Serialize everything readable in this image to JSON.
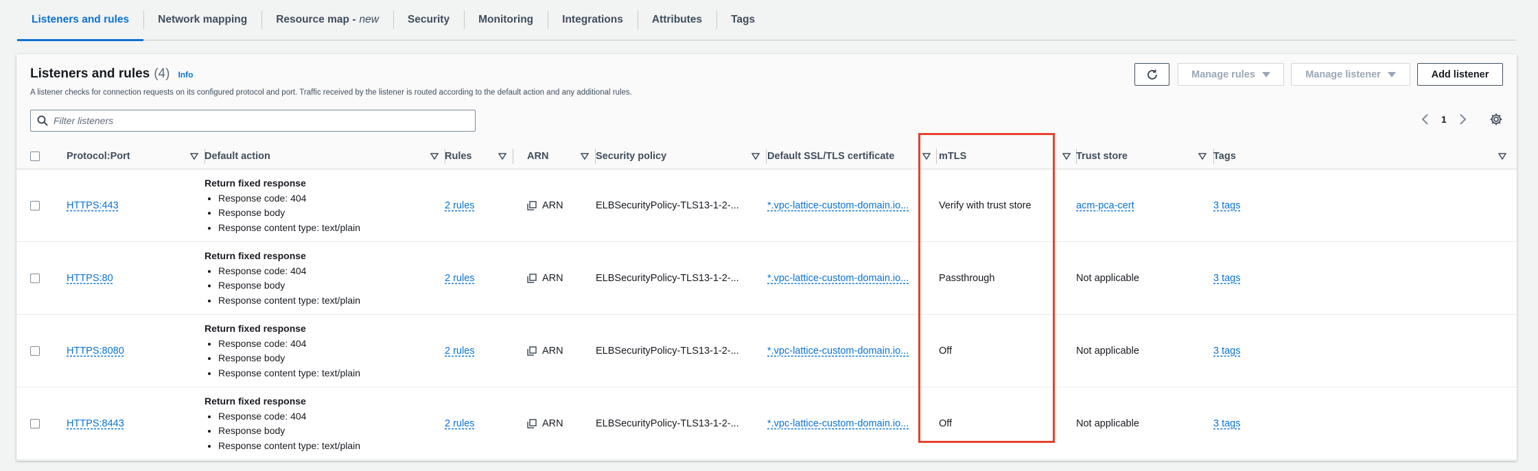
{
  "tabs": [
    {
      "label": "Listeners and rules",
      "active": true
    },
    {
      "label": "Network mapping"
    },
    {
      "label": "Resource map -",
      "suffix": "new"
    },
    {
      "label": "Security"
    },
    {
      "label": "Monitoring"
    },
    {
      "label": "Integrations"
    },
    {
      "label": "Attributes"
    },
    {
      "label": "Tags"
    }
  ],
  "header": {
    "title": "Listeners and rules",
    "count": "(4)",
    "info": "Info",
    "description": "A listener checks for connection requests on its configured protocol and port. Traffic received by the listener is routed according to the default action and any additional rules."
  },
  "buttons": {
    "manage_rules": "Manage rules",
    "manage_listener": "Manage listener",
    "add_listener": "Add listener"
  },
  "filter": {
    "placeholder": "Filter listeners",
    "value": ""
  },
  "pagination": {
    "current": "1"
  },
  "columns": {
    "protocol": "Protocol:Port",
    "default_action": "Default action",
    "rules": "Rules",
    "arn": "ARN",
    "security_policy": "Security policy",
    "certificate": "Default SSL/TLS certificate",
    "mtls": "mTLS",
    "trust_store": "Trust store",
    "tags": "Tags"
  },
  "rows": [
    {
      "protocol": "HTTPS:443",
      "action_head": "Return fixed response",
      "action_items": [
        "Response code: 404",
        "Response body",
        "Response content type: text/plain"
      ],
      "rules": "2 rules",
      "arn": "ARN",
      "security_policy": "ELBSecurityPolicy-TLS13-1-2-...",
      "certificate": "*.vpc-lattice-custom-domain.io...",
      "mtls": "Verify with trust store",
      "trust_store": "acm-pca-cert",
      "trust_store_link": true,
      "tags": "3 tags"
    },
    {
      "protocol": "HTTPS:80",
      "action_head": "Return fixed response",
      "action_items": [
        "Response code: 404",
        "Response body",
        "Response content type: text/plain"
      ],
      "rules": "2 rules",
      "arn": "ARN",
      "security_policy": "ELBSecurityPolicy-TLS13-1-2-...",
      "certificate": "*.vpc-lattice-custom-domain.io...",
      "mtls": "Passthrough",
      "trust_store": "Not applicable",
      "trust_store_link": false,
      "tags": "3 tags"
    },
    {
      "protocol": "HTTPS:8080",
      "action_head": "Return fixed response",
      "action_items": [
        "Response code: 404",
        "Response body",
        "Response content type: text/plain"
      ],
      "rules": "2 rules",
      "arn": "ARN",
      "security_policy": "ELBSecurityPolicy-TLS13-1-2-...",
      "certificate": "*.vpc-lattice-custom-domain.io...",
      "mtls": "Off",
      "trust_store": "Not applicable",
      "trust_store_link": false,
      "tags": "3 tags"
    },
    {
      "protocol": "HTTPS:8443",
      "action_head": "Return fixed response",
      "action_items": [
        "Response code: 404",
        "Response body",
        "Response content type: text/plain"
      ],
      "rules": "2 rules",
      "arn": "ARN",
      "security_policy": "ELBSecurityPolicy-TLS13-1-2-...",
      "certificate": "*.vpc-lattice-custom-domain.io...",
      "mtls": "Off",
      "trust_store": "Not applicable",
      "trust_store_link": false,
      "tags": "3 tags"
    }
  ],
  "colors": {
    "accent": "#0972d3",
    "highlight": "#e8412c"
  }
}
